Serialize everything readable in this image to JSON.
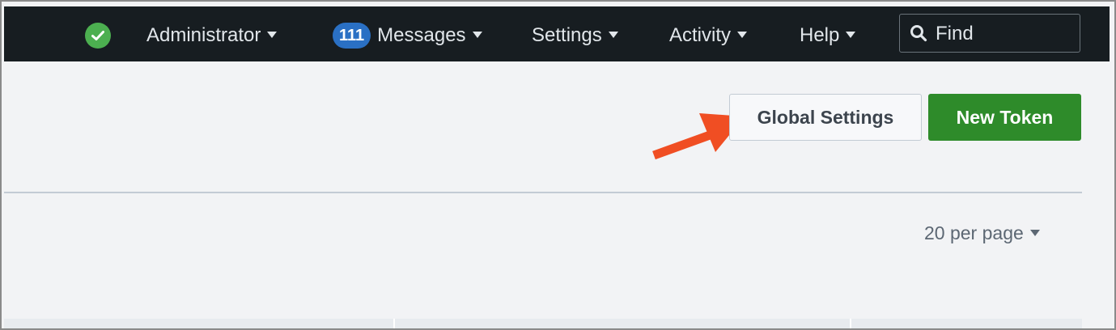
{
  "topbar": {
    "status_icon": "check-circle-icon",
    "status_color": "#4caf50",
    "administrator_label": "Administrator",
    "messages_count": "111",
    "messages_label": "Messages",
    "settings_label": "Settings",
    "activity_label": "Activity",
    "help_label": "Help",
    "find_placeholder": "Find",
    "background_color": "#171d21"
  },
  "actions": {
    "global_settings_label": "Global Settings",
    "new_token_label": "New Token",
    "primary_color": "#2e8b2a",
    "annotation_arrow_color": "#f04e23"
  },
  "pagination": {
    "per_page_label": "20 per page"
  }
}
